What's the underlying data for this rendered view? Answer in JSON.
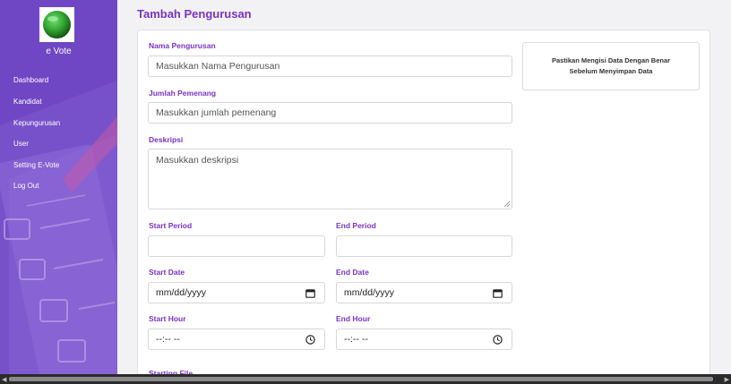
{
  "sidebar": {
    "brand": "e Vote",
    "items": [
      {
        "label": "Dashboard"
      },
      {
        "label": "Kandidat"
      },
      {
        "label": "Kepungurusan"
      },
      {
        "label": "User"
      },
      {
        "label": "Setting E-Vote"
      },
      {
        "label": "Log Out"
      }
    ],
    "colors": {
      "background": "#6f47c4",
      "logo_green": "#2e9e2e"
    }
  },
  "page": {
    "title": "Tambah Pengurusan",
    "accent": "#7a33c4"
  },
  "form": {
    "nama": {
      "label": "Nama Pengurusan",
      "placeholder": "Masukkan Nama Pengurusan"
    },
    "jumlah": {
      "label": "Jumlah Pemenang",
      "placeholder": "Masukkan jumlah pemenang"
    },
    "deskripsi": {
      "label": "Deskripsi",
      "placeholder": "Masukkan deskripsi"
    },
    "start_period": {
      "label": "Start Period",
      "value": ""
    },
    "end_period": {
      "label": "End Period",
      "value": ""
    },
    "start_date": {
      "label": "Start Date",
      "value": "mm/dd/yyyy"
    },
    "end_date": {
      "label": "End Date",
      "value": "mm/dd/yyyy"
    },
    "start_hour": {
      "label": "Start Hour",
      "value": "--:-- --"
    },
    "end_hour": {
      "label": "End Hour",
      "value": "--:-- --"
    },
    "starting_file": {
      "label": "Starting File"
    }
  },
  "notice": {
    "text": "Pastikan Mengisi Data Dengan Benar Sebelum Menyimpan Data"
  }
}
